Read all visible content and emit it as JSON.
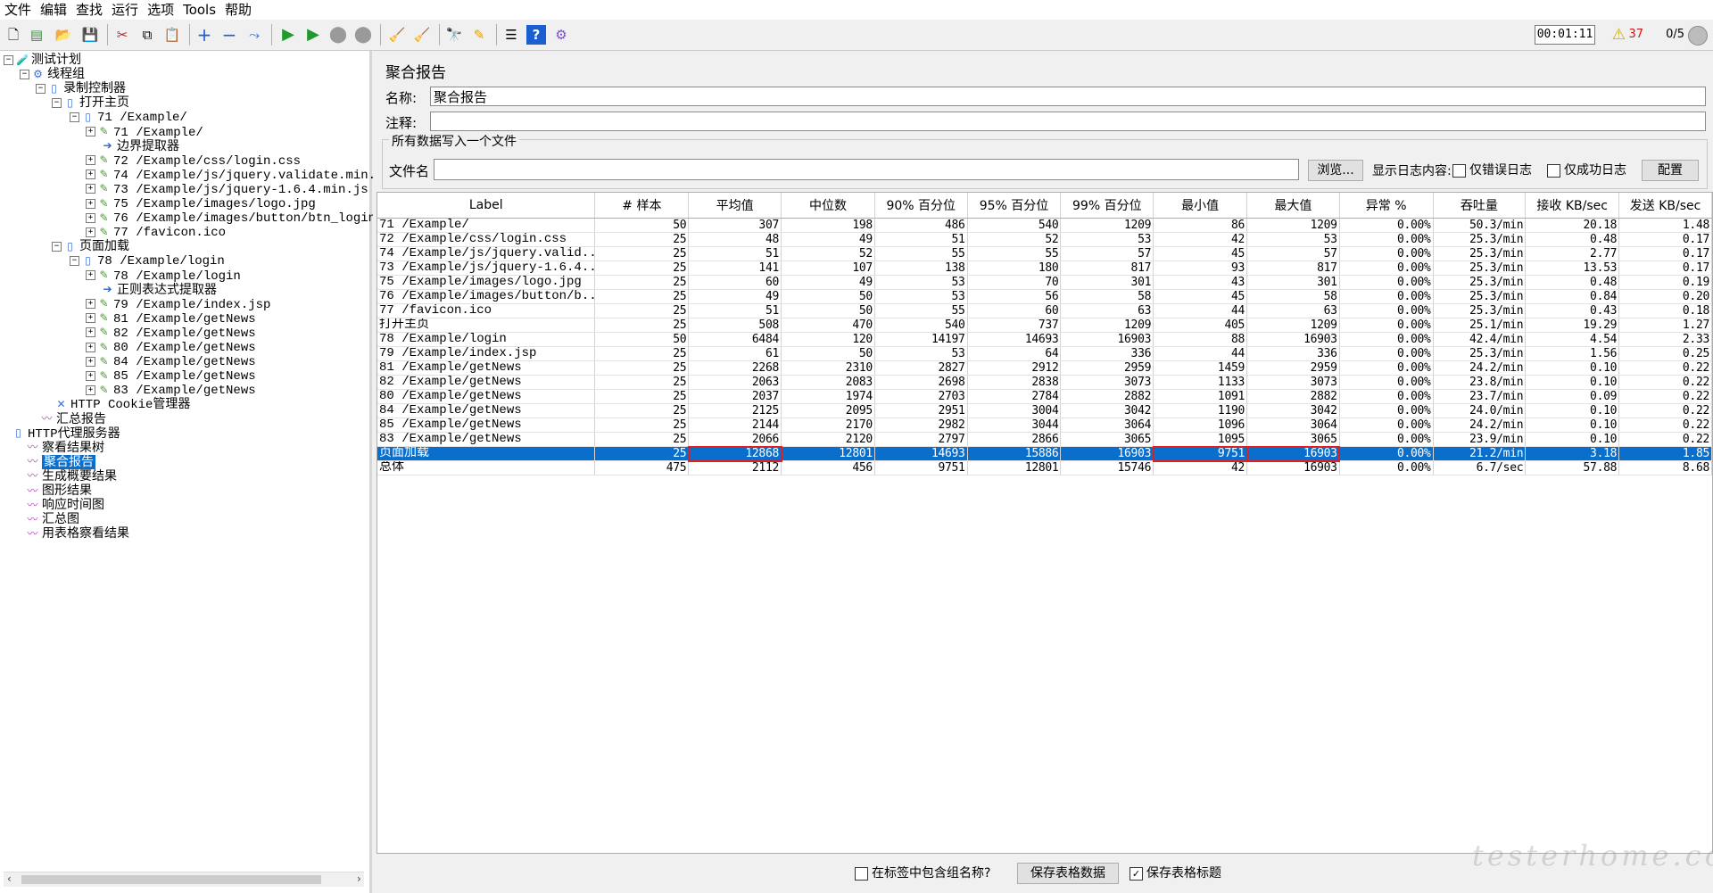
{
  "menu": [
    "文件",
    "编辑",
    "查找",
    "运行",
    "选项",
    "Tools",
    "帮助"
  ],
  "toolbar": {
    "timer": "00:01:11",
    "warning_count": "37",
    "threads": "0/5"
  },
  "tree": [
    {
      "label": "测试计划",
      "icon": "testplan-icon",
      "cjk": true
    },
    {
      "label": "线程组",
      "icon": "threadgroup-icon",
      "cjk": true
    },
    {
      "label": "录制控制器",
      "icon": "controller-icon",
      "cjk": true
    },
    {
      "label": "打开主页",
      "icon": "controller-icon",
      "cjk": true
    },
    {
      "label": "71 /Example/",
      "icon": "controller-icon",
      "cjk": false
    },
    {
      "label": "71 /Example/",
      "icon": "sampler-icon",
      "cjk": false
    },
    {
      "label": "边界提取器",
      "icon": "extractor-icon",
      "cjk": true
    },
    {
      "label": "72 /Example/css/login.css",
      "icon": "sampler-icon",
      "cjk": false
    },
    {
      "label": "74 /Example/js/jquery.validate.min.",
      "icon": "sampler-icon",
      "cjk": false
    },
    {
      "label": "73 /Example/js/jquery-1.6.4.min.js",
      "icon": "sampler-icon",
      "cjk": false
    },
    {
      "label": "75 /Example/images/logo.jpg",
      "icon": "sampler-icon",
      "cjk": false
    },
    {
      "label": "76 /Example/images/button/btn_login",
      "icon": "sampler-icon",
      "cjk": false
    },
    {
      "label": "77 /favicon.ico",
      "icon": "sampler-icon",
      "cjk": false
    },
    {
      "label": "页面加载",
      "icon": "controller-icon",
      "cjk": true
    },
    {
      "label": "78 /Example/login",
      "icon": "controller-icon",
      "cjk": false
    },
    {
      "label": "78 /Example/login",
      "icon": "sampler-icon",
      "cjk": false
    },
    {
      "label": "正则表达式提取器",
      "icon": "extractor-icon",
      "cjk": true
    },
    {
      "label": "79 /Example/index.jsp",
      "icon": "sampler-icon",
      "cjk": false
    },
    {
      "label": "81 /Example/getNews",
      "icon": "sampler-icon",
      "cjk": false
    },
    {
      "label": "82 /Example/getNews",
      "icon": "sampler-icon",
      "cjk": false
    },
    {
      "label": "80 /Example/getNews",
      "icon": "sampler-icon",
      "cjk": false
    },
    {
      "label": "84 /Example/getNews",
      "icon": "sampler-icon",
      "cjk": false
    },
    {
      "label": "85 /Example/getNews",
      "icon": "sampler-icon",
      "cjk": false
    },
    {
      "label": "83 /Example/getNews",
      "icon": "sampler-icon",
      "cjk": false
    },
    {
      "label": "HTTP Cookie管理器",
      "icon": "config-icon",
      "cjk": false
    },
    {
      "label": "汇总报告",
      "icon": "listener-icon",
      "cjk": true
    },
    {
      "label": "HTTP代理服务器",
      "icon": "proxy-icon",
      "cjk": false
    },
    {
      "label": "察看结果树",
      "icon": "listener-icon",
      "cjk": true
    },
    {
      "label": "聚合报告",
      "icon": "listener-icon",
      "cjk": true,
      "selected": true
    },
    {
      "label": "生成概要结果",
      "icon": "listener-icon",
      "cjk": true
    },
    {
      "label": "图形结果",
      "icon": "listener-icon",
      "cjk": true
    },
    {
      "label": "响应时间图",
      "icon": "listener-icon",
      "cjk": true
    },
    {
      "label": "汇总图",
      "icon": "listener-icon",
      "cjk": true
    },
    {
      "label": "用表格察看结果",
      "icon": "listener-icon",
      "cjk": true
    }
  ],
  "panel": {
    "title": "聚合报告",
    "name_label": "名称:",
    "name_value": "聚合报告",
    "comment_label": "注释:",
    "comment_value": "",
    "group_title": "所有数据写入一个文件",
    "filename_label": "文件名",
    "filename_value": "",
    "browse_button": "浏览...",
    "log_content_label": "显示日志内容:",
    "errors_only": "仅错误日志",
    "success_only": "仅成功日志",
    "configure_button": "配置"
  },
  "table": {
    "columns": [
      "Label",
      "# 样本",
      "平均值",
      "中位数",
      "90% 百分位",
      "95% 百分位",
      "99% 百分位",
      "最小值",
      "最大值",
      "异常 %",
      "吞吐量",
      "接收 KB/sec",
      "发送 KB/sec"
    ],
    "rows": [
      [
        "71 /Example/",
        "50",
        "307",
        "198",
        "486",
        "540",
        "1209",
        "86",
        "1209",
        "0.00%",
        "50.3/min",
        "20.18",
        "1.48"
      ],
      [
        "72 /Example/css/login.css",
        "25",
        "48",
        "49",
        "51",
        "52",
        "53",
        "42",
        "53",
        "0.00%",
        "25.3/min",
        "0.48",
        "0.17"
      ],
      [
        "74 /Example/js/jquery.valid...",
        "25",
        "51",
        "52",
        "55",
        "55",
        "57",
        "45",
        "57",
        "0.00%",
        "25.3/min",
        "2.77",
        "0.17"
      ],
      [
        "73 /Example/js/jquery-1.6.4...",
        "25",
        "141",
        "107",
        "138",
        "180",
        "817",
        "93",
        "817",
        "0.00%",
        "25.3/min",
        "13.53",
        "0.17"
      ],
      [
        "75 /Example/images/logo.jpg",
        "25",
        "60",
        "49",
        "53",
        "70",
        "301",
        "43",
        "301",
        "0.00%",
        "25.3/min",
        "0.48",
        "0.19"
      ],
      [
        "76 /Example/images/button/b...",
        "25",
        "49",
        "50",
        "53",
        "56",
        "58",
        "45",
        "58",
        "0.00%",
        "25.3/min",
        "0.84",
        "0.20"
      ],
      [
        "77 /favicon.ico",
        "25",
        "51",
        "50",
        "55",
        "60",
        "63",
        "44",
        "63",
        "0.00%",
        "25.3/min",
        "0.43",
        "0.18"
      ],
      [
        "打开主页",
        "25",
        "508",
        "470",
        "540",
        "737",
        "1209",
        "405",
        "1209",
        "0.00%",
        "25.1/min",
        "19.29",
        "1.27"
      ],
      [
        "78 /Example/login",
        "50",
        "6484",
        "120",
        "14197",
        "14693",
        "16903",
        "88",
        "16903",
        "0.00%",
        "42.4/min",
        "4.54",
        "2.33"
      ],
      [
        "79 /Example/index.jsp",
        "25",
        "61",
        "50",
        "53",
        "64",
        "336",
        "44",
        "336",
        "0.00%",
        "25.3/min",
        "1.56",
        "0.25"
      ],
      [
        "81 /Example/getNews",
        "25",
        "2268",
        "2310",
        "2827",
        "2912",
        "2959",
        "1459",
        "2959",
        "0.00%",
        "24.2/min",
        "0.10",
        "0.22"
      ],
      [
        "82 /Example/getNews",
        "25",
        "2063",
        "2083",
        "2698",
        "2838",
        "3073",
        "1133",
        "3073",
        "0.00%",
        "23.8/min",
        "0.10",
        "0.22"
      ],
      [
        "80 /Example/getNews",
        "25",
        "2037",
        "1974",
        "2703",
        "2784",
        "2882",
        "1091",
        "2882",
        "0.00%",
        "23.7/min",
        "0.09",
        "0.22"
      ],
      [
        "84 /Example/getNews",
        "25",
        "2125",
        "2095",
        "2951",
        "3004",
        "3042",
        "1190",
        "3042",
        "0.00%",
        "24.0/min",
        "0.10",
        "0.22"
      ],
      [
        "85 /Example/getNews",
        "25",
        "2144",
        "2170",
        "2982",
        "3044",
        "3064",
        "1096",
        "3064",
        "0.00%",
        "24.2/min",
        "0.10",
        "0.22"
      ],
      [
        "83 /Example/getNews",
        "25",
        "2066",
        "2120",
        "2797",
        "2866",
        "3065",
        "1095",
        "3065",
        "0.00%",
        "23.9/min",
        "0.10",
        "0.22"
      ],
      [
        "页面加载",
        "25",
        "12868",
        "12801",
        "14693",
        "15886",
        "16903",
        "9751",
        "16903",
        "0.00%",
        "21.2/min",
        "3.18",
        "1.85"
      ],
      [
        "总体",
        "475",
        "2112",
        "456",
        "9751",
        "12801",
        "15746",
        "42",
        "16903",
        "0.00%",
        "6.7/sec",
        "57.88",
        "8.68"
      ]
    ],
    "selected_row": 16
  },
  "bottom": {
    "include_group_name": "在标签中包含组名称?",
    "save_table_data": "保存表格数据",
    "save_table_header": "保存表格标题"
  },
  "watermark": "testerhome.com",
  "colors": {
    "selection": "#0a6ecc",
    "highlight_box": "#e02020",
    "warning_count": "#d21414"
  }
}
